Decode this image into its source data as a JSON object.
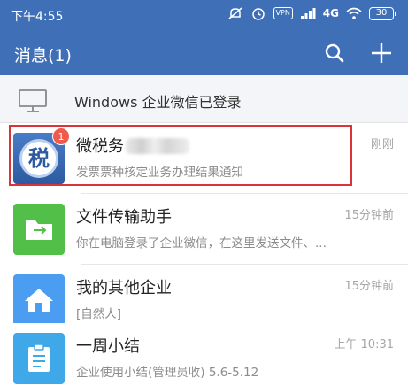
{
  "status_bar": {
    "time": "下午4:55",
    "vpn": "VPN",
    "network": "4G",
    "battery": "30"
  },
  "header": {
    "title": "消息(1)"
  },
  "login_banner": {
    "text": "Windows 企业微信已登录"
  },
  "conversations": [
    {
      "title": "微税务",
      "subtitle": "发票票种核定业务办理结果通知",
      "time": "刚刚",
      "badge": "1",
      "avatar_glyph": "税",
      "icon": "tax-icon",
      "accent": "#2d5aa0"
    },
    {
      "title": "文件传输助手",
      "subtitle": "你在电脑登录了企业微信，在这里发送文件、...",
      "time": "15分钟前",
      "icon": "folder-icon",
      "accent": "#52c048"
    },
    {
      "title": "我的其他企业",
      "subtitle": "[自然人]",
      "time": "15分钟前",
      "icon": "house-icon",
      "accent": "#4a9df0"
    },
    {
      "title": "一周小结",
      "subtitle": "企业使用小结(管理员收) 5.6-5.12",
      "time": "上午 10:31",
      "icon": "clipboard-icon",
      "accent": "#3ea8e8"
    }
  ],
  "colors": {
    "header_bg": "#3f6fb7",
    "badge": "#f05a4c",
    "highlight": "#d9343a"
  }
}
